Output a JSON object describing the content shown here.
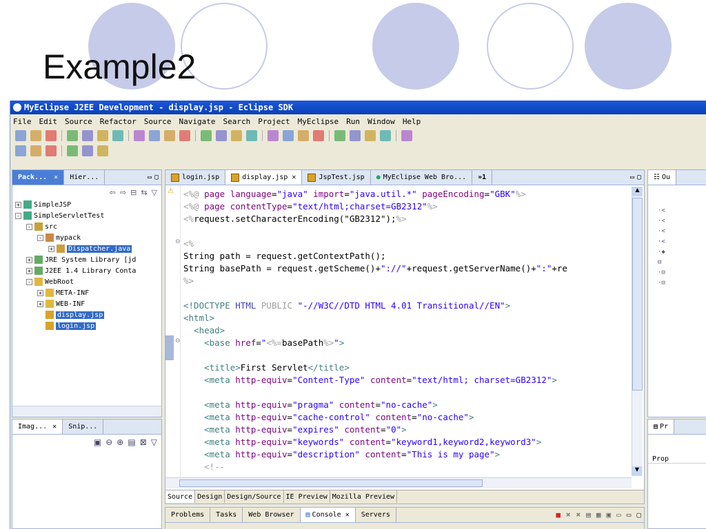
{
  "slide": {
    "title": "Example2"
  },
  "window": {
    "title": "MyEclipse J2EE Development - display.jsp - Eclipse SDK"
  },
  "menu": [
    "File",
    "Edit",
    "Source",
    "Refactor",
    "Source",
    "Navigate",
    "Search",
    "Project",
    "MyEclipse",
    "Run",
    "Window",
    "Help"
  ],
  "left_panel": {
    "tabs": [
      "Pack...",
      "Hier..."
    ],
    "tree": [
      {
        "label": "SimpleJSP",
        "level": 0,
        "exp": "+",
        "icon": "project-icon",
        "selected": false
      },
      {
        "label": "SimpleServletTest",
        "level": 0,
        "exp": "-",
        "icon": "project-icon",
        "selected": false
      },
      {
        "label": "src",
        "level": 1,
        "exp": "-",
        "icon": "source-folder-icon",
        "selected": false
      },
      {
        "label": "mypack",
        "level": 2,
        "exp": "-",
        "icon": "package-icon",
        "selected": false
      },
      {
        "label": "Dispatcher.java",
        "level": 3,
        "exp": "+",
        "icon": "java-file-icon",
        "selected": true
      },
      {
        "label": "JRE System Library [jd",
        "level": 1,
        "exp": "+",
        "icon": "library-icon",
        "selected": false
      },
      {
        "label": "J2EE 1.4 Library Conta",
        "level": 1,
        "exp": "+",
        "icon": "library-icon",
        "selected": false
      },
      {
        "label": "WebRoot",
        "level": 1,
        "exp": "-",
        "icon": "folder-icon",
        "selected": false
      },
      {
        "label": "META-INF",
        "level": 2,
        "exp": "+",
        "icon": "folder-icon",
        "selected": false
      },
      {
        "label": "WEB-INF",
        "level": 2,
        "exp": "+",
        "icon": "folder-icon",
        "selected": false
      },
      {
        "label": "display.jsp",
        "level": 2,
        "exp": "",
        "icon": "jsp-file-icon",
        "selected": true
      },
      {
        "label": "login.jsp",
        "level": 2,
        "exp": "",
        "icon": "jsp-file-icon",
        "selected": true
      }
    ]
  },
  "lower_left": {
    "tabs": [
      "Imag...",
      "Snip..."
    ]
  },
  "editor": {
    "tabs": [
      "login.jsp",
      "display.jsp",
      "JspTest.jsp",
      "MyEclipse Web Bro..."
    ],
    "overflow": "»1",
    "lines": [
      [
        [
          "dim",
          "<%@ "
        ],
        [
          "att",
          "page "
        ],
        [
          "att",
          "language"
        ],
        [
          "",
          "="
        ],
        [
          "str",
          "\"java\""
        ],
        [
          "att",
          " import"
        ],
        [
          "",
          "="
        ],
        [
          "str",
          "\"java.util.*\""
        ],
        [
          "att",
          " pageEncoding"
        ],
        [
          "",
          "="
        ],
        [
          "str",
          "\"GBK\""
        ],
        [
          "dim",
          "%>"
        ]
      ],
      [
        [
          "dim",
          "<%@ "
        ],
        [
          "att",
          "page "
        ],
        [
          "att",
          "contentType"
        ],
        [
          "",
          "="
        ],
        [
          "str",
          "\"text/html;charset=GB2312\""
        ],
        [
          "dim",
          "%>"
        ]
      ],
      [
        [
          "dim",
          "<%"
        ],
        [
          "",
          "request.setCharacterEncoding(\"GB2312\");"
        ],
        [
          "dim",
          "%>"
        ]
      ],
      [],
      [
        [
          "dim",
          "<%"
        ]
      ],
      [
        [
          "",
          "String path = request.getContextPath();"
        ]
      ],
      [
        [
          "",
          "String basePath = request.getScheme()+"
        ],
        [
          "str",
          "\"://\""
        ],
        [
          "",
          "+request.getServerName()+"
        ],
        [
          "str",
          "\":\""
        ],
        [
          "",
          "+re"
        ]
      ],
      [
        [
          "dim",
          "%>"
        ]
      ],
      [],
      [
        [
          "tag",
          "<!DOCTYPE "
        ],
        [
          "kw",
          "HTML "
        ],
        [
          "dim",
          "PUBLIC "
        ],
        [
          "str",
          "\"-//W3C//DTD HTML 4.01 Transitional//EN\""
        ],
        [
          "tag",
          ">"
        ]
      ],
      [
        [
          "tag",
          "<html>"
        ]
      ],
      [
        [
          "tag",
          "  <head>"
        ]
      ],
      [
        [
          "tag",
          "    <base "
        ],
        [
          "att",
          "href"
        ],
        [
          "",
          "="
        ],
        [
          "str",
          "\""
        ],
        [
          "dim",
          "<%="
        ],
        [
          "",
          "basePath"
        ],
        [
          "dim",
          "%>"
        ],
        [
          "str",
          "\""
        ],
        [
          "tag",
          ">"
        ]
      ],
      [],
      [
        [
          "tag",
          "    <title>"
        ],
        [
          "",
          "First Servlet"
        ],
        [
          "tag",
          "</title>"
        ]
      ],
      [
        [
          "tag",
          "    <meta "
        ],
        [
          "att",
          "http-equiv"
        ],
        [
          "",
          "="
        ],
        [
          "str",
          "\"Content-Type\""
        ],
        [
          "att",
          " content"
        ],
        [
          "",
          "="
        ],
        [
          "str",
          "\"text/html; charset=GB2312\""
        ],
        [
          "tag",
          ">"
        ]
      ],
      [],
      [
        [
          "tag",
          "    <meta "
        ],
        [
          "att",
          "http-equiv"
        ],
        [
          "",
          "="
        ],
        [
          "str",
          "\"pragma\""
        ],
        [
          "att",
          " content"
        ],
        [
          "",
          "="
        ],
        [
          "str",
          "\"no-cache\""
        ],
        [
          "tag",
          ">"
        ]
      ],
      [
        [
          "tag",
          "    <meta "
        ],
        [
          "att",
          "http-equiv"
        ],
        [
          "",
          "="
        ],
        [
          "str",
          "\"cache-control\""
        ],
        [
          "att",
          " content"
        ],
        [
          "",
          "="
        ],
        [
          "str",
          "\"no-cache\""
        ],
        [
          "tag",
          ">"
        ]
      ],
      [
        [
          "tag",
          "    <meta "
        ],
        [
          "att",
          "http-equiv"
        ],
        [
          "",
          "="
        ],
        [
          "str",
          "\"expires\""
        ],
        [
          "att",
          " content"
        ],
        [
          "",
          "="
        ],
        [
          "str",
          "\"0\""
        ],
        [
          "tag",
          ">"
        ]
      ],
      [
        [
          "tag",
          "    <meta "
        ],
        [
          "att",
          "http-equiv"
        ],
        [
          "",
          "="
        ],
        [
          "str",
          "\"keywords\""
        ],
        [
          "att",
          " content"
        ],
        [
          "",
          "="
        ],
        [
          "str",
          "\"keyword1,keyword2,keyword3\""
        ],
        [
          "tag",
          ">"
        ]
      ],
      [
        [
          "tag",
          "    <meta "
        ],
        [
          "att",
          "http-equiv"
        ],
        [
          "",
          "="
        ],
        [
          "str",
          "\"description\""
        ],
        [
          "att",
          " content"
        ],
        [
          "",
          "="
        ],
        [
          "str",
          "\"This is my page\""
        ],
        [
          "tag",
          ">"
        ]
      ],
      [
        [
          "dim",
          "    <!--"
        ]
      ]
    ],
    "bottom_tabs": [
      "Source",
      "Design",
      "Design/Source",
      "IE Preview",
      "Mozilla Preview"
    ]
  },
  "console": {
    "tabs": [
      "Problems",
      "Tasks",
      "Web Browser",
      "Console",
      "Servers"
    ]
  },
  "right_panel": {
    "tab": "Ou",
    "lower_tab": "Pr",
    "lower_label": "Prop"
  },
  "colors": {
    "selection": "#316ac5",
    "titlebar": "#0a3fb8",
    "circle": "#c5cbe8"
  }
}
